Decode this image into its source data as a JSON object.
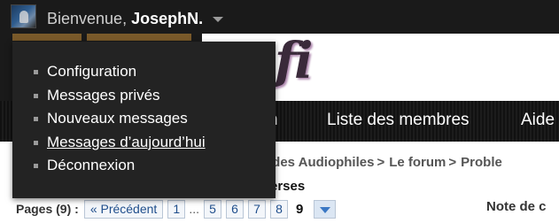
{
  "topbar": {
    "welcome_prefix": "Bienvenue, ",
    "username": "JosephN."
  },
  "header": {
    "logo_fragment": "fi"
  },
  "nav": {
    "items": [
      "n",
      "Liste des membres",
      "Aide"
    ]
  },
  "breadcrumb": {
    "items": [
      "t des Audiophiles",
      "Le forum",
      "Proble"
    ]
  },
  "subtitle": "erses",
  "pagination": {
    "label": "Pages (9) :",
    "prev": "« Précédent",
    "pages": [
      "1",
      "5",
      "6",
      "7",
      "8"
    ],
    "ellipsis": "...",
    "current": "9"
  },
  "rating_label": "Note de c",
  "user_menu": {
    "items": [
      "Configuration",
      "Messages privés",
      "Nouveaux messages",
      "Messages d’aujourd’hui",
      "Déconnexion"
    ],
    "hover_index": 3
  }
}
